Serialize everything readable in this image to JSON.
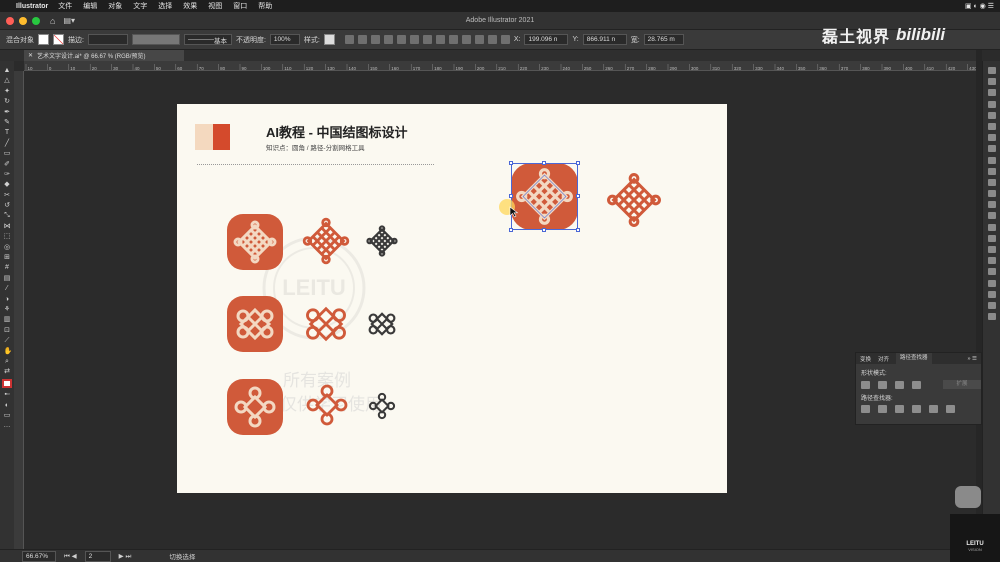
{
  "menubar": {
    "app_name": "Illustrator",
    "items": [
      "文件",
      "编辑",
      "对象",
      "文字",
      "选择",
      "效果",
      "视图",
      "窗口",
      "帮助"
    ]
  },
  "appbar": {
    "title": "Adobe Illustrator 2021"
  },
  "controlbar": {
    "selection_label": "混合对象",
    "stroke_label": "描边:",
    "stroke_style": "基本",
    "opacity_label": "不透明度:",
    "opacity_value": "100%",
    "style_label": "样式:",
    "x_label": "X:",
    "x_value": "199.096 n",
    "y_label": "Y:",
    "y_value": "866.911 n",
    "w_label": "宽:",
    "w_value": "28.765 m"
  },
  "doc_tab": {
    "label": "艺术文字设计.ai* @ 66.67 % (RGB/预览)"
  },
  "ruler": {
    "ticks": [
      "10",
      "0",
      "10",
      "20",
      "30",
      "40",
      "50",
      "60",
      "70",
      "80",
      "90",
      "100",
      "110",
      "120",
      "130",
      "140",
      "150",
      "160",
      "170",
      "180",
      "190",
      "200",
      "210",
      "220",
      "230",
      "240",
      "250",
      "260",
      "270",
      "280",
      "290",
      "300",
      "310",
      "320",
      "330",
      "340",
      "350",
      "360",
      "370",
      "380",
      "390",
      "400",
      "410",
      "420",
      "430"
    ]
  },
  "artboard": {
    "title": "AI教程 - 中国结图标设计",
    "subtitle": "知识点：圆角 / 路径-分割网格工具",
    "watermark_line1": "所有案例",
    "watermark_line2": "仅供学习使用",
    "watermark_brand": "LEITU"
  },
  "colors": {
    "accent_red": "#d05a3a",
    "light_knot": "#f3d8c2",
    "dark_knot": "#3a3a3a",
    "selection_blue": "#4a67d6"
  },
  "pathfinder": {
    "tabs": [
      "变换",
      "对齐",
      "路径查找器"
    ],
    "shape_modes_label": "形状模式:",
    "expand_label": "扩展",
    "pathfinders_label": "路径查找器:"
  },
  "statusbar": {
    "zoom": "66.67%",
    "page": "2",
    "tool_label": "切换选择"
  },
  "overlay": {
    "brand_name": "磊土视界",
    "brand_platform": "bilibili",
    "logo_text": "LEITU",
    "logo_sub": "VISION"
  }
}
